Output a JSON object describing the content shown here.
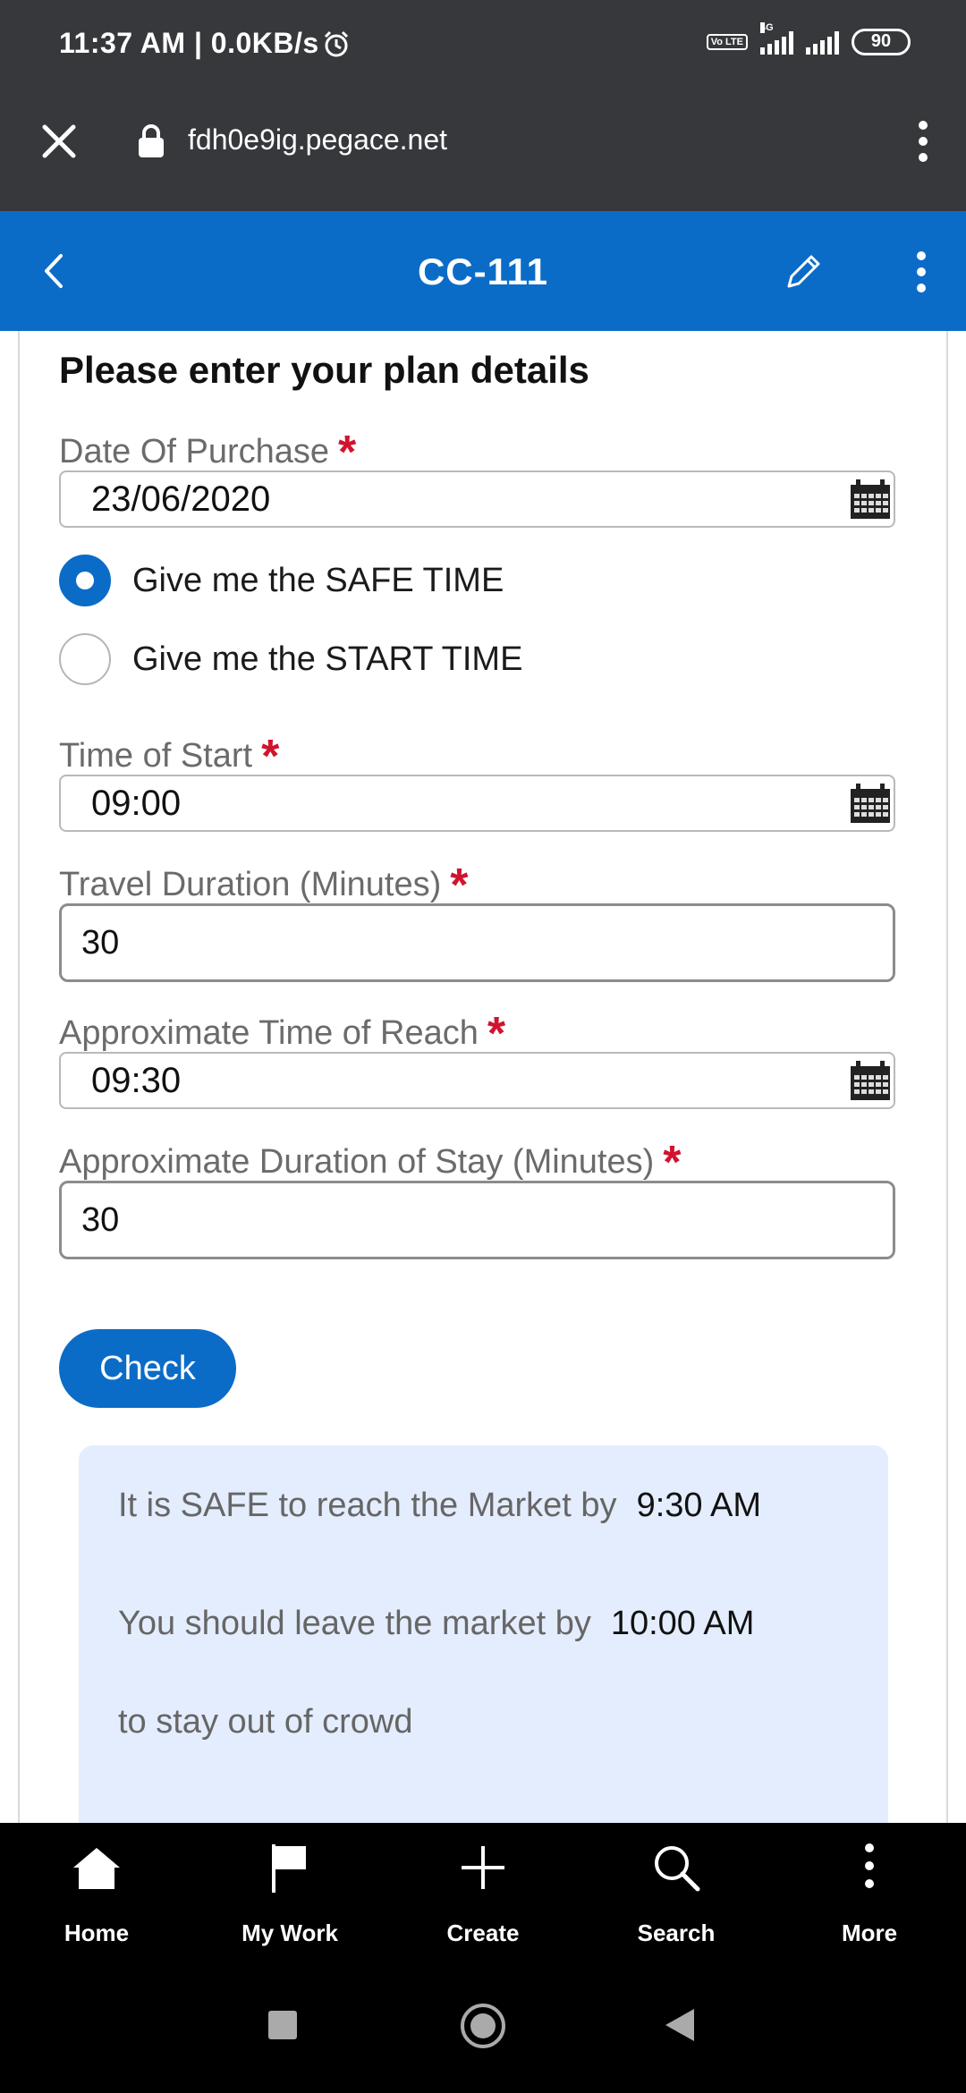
{
  "status_bar": {
    "time": "11:37 AM | 0.0KB/s",
    "network_type": "4G",
    "volte": "Vo LTE",
    "battery": "90"
  },
  "browser": {
    "url": "fdh0e9ig.pegace.net"
  },
  "app_header": {
    "title": "CC-111"
  },
  "form": {
    "section_title": "Please enter your plan details",
    "date_of_purchase": {
      "label": "Date Of Purchase",
      "value": "23/06/2020"
    },
    "radio_options": [
      {
        "label": "Give me the SAFE TIME",
        "checked": true
      },
      {
        "label": "Give me the START TIME",
        "checked": false
      }
    ],
    "time_of_start": {
      "label": "Time of Start",
      "value": "09:00"
    },
    "travel_duration": {
      "label": "Travel Duration (Minutes)",
      "value": "30"
    },
    "time_of_reach": {
      "label": "Approximate Time of Reach",
      "value": "09:30"
    },
    "duration_of_stay": {
      "label": "Approximate Duration of Stay (Minutes)",
      "value": "30"
    },
    "required_marker": "*",
    "check_button": "Check"
  },
  "result": {
    "line1_text": "It is SAFE to reach the Market by",
    "line1_value": "9:30 AM",
    "line2_text": "You should leave the market by",
    "line2_value": "10:00 AM",
    "line3_text": "to stay out of crowd"
  },
  "bottom_nav": [
    {
      "label": "Home",
      "icon": "home-icon"
    },
    {
      "label": "My Work",
      "icon": "flag-icon"
    },
    {
      "label": "Create",
      "icon": "plus-icon"
    },
    {
      "label": "Search",
      "icon": "search-icon"
    },
    {
      "label": "More",
      "icon": "more-vertical-icon"
    }
  ],
  "colors": {
    "header_blue": "#0b6cc8",
    "required_red": "#d0142f",
    "result_bg": "#e4edfd",
    "status_bar": "#37383c"
  }
}
